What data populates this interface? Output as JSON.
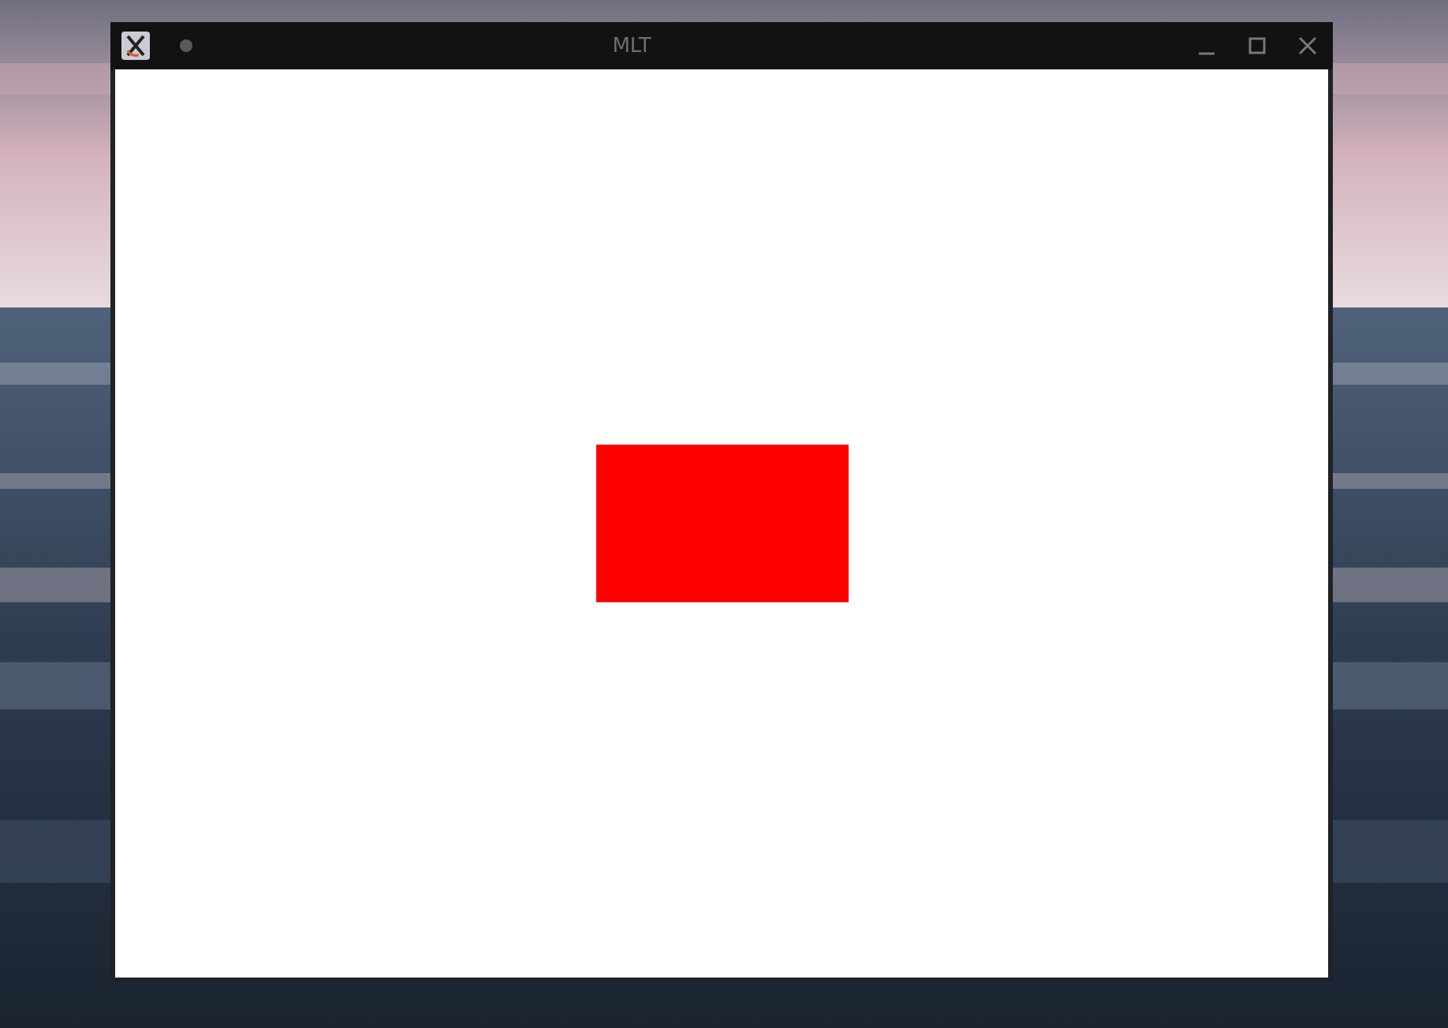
{
  "window": {
    "title": "MLT"
  }
}
